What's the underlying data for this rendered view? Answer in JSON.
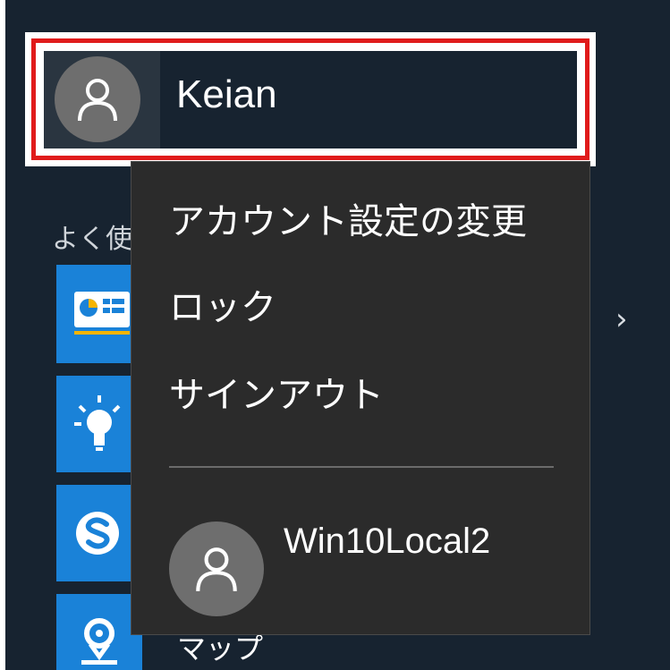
{
  "start": {
    "user": {
      "name": "Keian"
    },
    "section_label": "よく使",
    "apps": [
      {
        "icon": "dashboard-app-icon"
      },
      {
        "icon": "tips-lightbulb-icon"
      },
      {
        "icon": "skype-icon"
      },
      {
        "icon": "maps-pin-icon",
        "label": "マップ"
      }
    ],
    "chevron": "›"
  },
  "user_menu": {
    "items": [
      {
        "label": "アカウント設定の変更"
      },
      {
        "label": "ロック"
      },
      {
        "label": "サインアウト"
      }
    ],
    "other_account": {
      "name": "Win10Local2"
    }
  },
  "colors": {
    "panel_bg": "#172330",
    "menu_bg": "#2b2b2b",
    "highlight": "#e01b1b",
    "tile_blue": "#1a82d8"
  }
}
